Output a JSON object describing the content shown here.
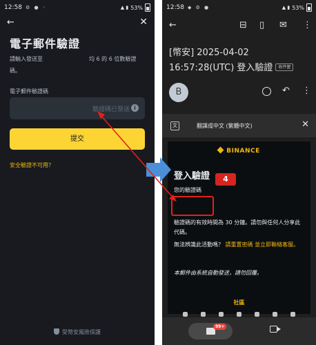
{
  "colors": {
    "left_bg": "#181a20",
    "right_bg": "#1f1f1f",
    "binance_yellow": "#fcd535",
    "annotation_red": "#e32119",
    "flow_arrow_blue": "#4a90d9"
  },
  "left_phone": {
    "status": {
      "time": "12:58",
      "battery": "53%"
    },
    "back_icon": "←",
    "close_icon": "✕",
    "title": "電子郵件驗證",
    "desc_part1": "請輸入發送至",
    "desc_part2": "均 6 的 6 位數驗證",
    "desc_part3": "碼。",
    "field_label": "電子郵件驗證碼",
    "input_hint": "驗證碼已發送",
    "submit_label": "提交",
    "security_link": "安全驗證不可用？",
    "footer_text": "受幣安風險保護"
  },
  "right_phone": {
    "status": {
      "time": "12:58",
      "battery": "53%"
    },
    "subject_line1": "[幣安] 2025-04-02",
    "subject_line2": "16:57:28(UTC) 登入驗證",
    "inbox_badge": "收件匣",
    "sender_avatar": "B",
    "translate_text": "翻譯成中文 (繁體中文)",
    "email": {
      "logo": "BINANCE",
      "heading": "登入驗證",
      "code_label": "您的驗證碼",
      "validity": "驗證碼的有效時間為 30 分鐘。請勿與任何人分享此代碼。",
      "question": "無法辨識此活動嗎？",
      "reset_link": "請重置密碼 並立即聯絡客服。",
      "auto_note": "本郵件由系統自動發送，請勿回覆。",
      "community": "社區"
    },
    "unread_badge": "99+"
  },
  "annotation": {
    "step": "4"
  }
}
